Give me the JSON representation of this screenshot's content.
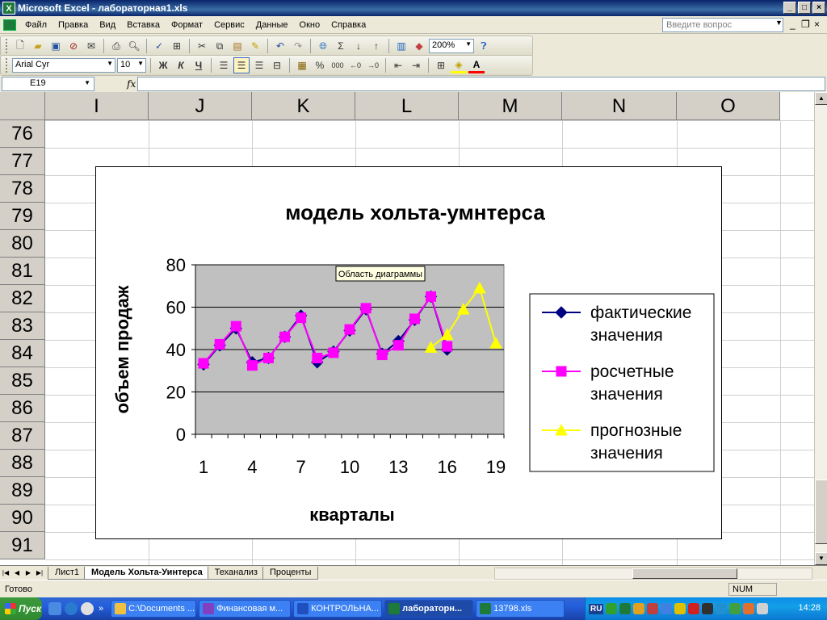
{
  "window": {
    "title": "Microsoft Excel - лабораторная1.xls",
    "minimize": "_",
    "maximize": "□",
    "close": "×"
  },
  "menu": {
    "items": [
      "Файл",
      "Правка",
      "Вид",
      "Вставка",
      "Формат",
      "Сервис",
      "Данные",
      "Окно",
      "Справка"
    ],
    "ask_placeholder": "Введите вопрос"
  },
  "toolbar": {
    "zoom": "200%",
    "font_name": "Arial Cyr",
    "font_size": "10",
    "bold": "Ж",
    "italic": "К",
    "underline": "Ч",
    "percent": "%",
    "thousands": "000",
    "sum": "Σ"
  },
  "formula_bar": {
    "name_box": "E19",
    "fx": "fx",
    "content": ""
  },
  "sheet": {
    "columns": [
      "I",
      "J",
      "K",
      "L",
      "M",
      "N",
      "O"
    ],
    "rows": [
      "76",
      "77",
      "78",
      "79",
      "80",
      "81",
      "82",
      "83",
      "84",
      "85",
      "86",
      "87",
      "88",
      "89",
      "90",
      "91"
    ]
  },
  "chart_data": {
    "type": "line",
    "title": "модель хольта-умнтерса",
    "xlabel": "кварталы",
    "ylabel": "объем продаж",
    "tooltip": "Область диаграммы",
    "x": [
      1,
      2,
      3,
      4,
      5,
      6,
      7,
      8,
      9,
      10,
      11,
      12,
      13,
      14,
      15,
      16,
      17,
      18,
      19
    ],
    "x_tick_labels": [
      "1",
      "4",
      "7",
      "10",
      "13",
      "16",
      "19"
    ],
    "ylim": [
      0,
      80
    ],
    "y_ticks": [
      0,
      20,
      40,
      60,
      80
    ],
    "grid": true,
    "legend_position": "right",
    "plot_background": "#c0c0c0",
    "series": [
      {
        "name": "фактические значения",
        "color": "#000080",
        "marker": "diamond",
        "x": [
          1,
          2,
          3,
          4,
          5,
          6,
          7,
          8,
          9,
          10,
          11,
          12,
          13,
          14,
          15,
          16
        ],
        "values": [
          33,
          42,
          50,
          34,
          36,
          46,
          56,
          34,
          39,
          49,
          59,
          38,
          44,
          54,
          65,
          40
        ]
      },
      {
        "name": "росчетные значения",
        "color": "#ff00ff",
        "marker": "square",
        "x": [
          1,
          2,
          3,
          4,
          5,
          6,
          7,
          8,
          9,
          10,
          11,
          12,
          13,
          14,
          15,
          16
        ],
        "values": [
          33.5,
          42.5,
          51,
          32.5,
          36,
          46,
          55,
          36,
          38.5,
          49.5,
          59.5,
          37.5,
          42,
          54.5,
          65,
          41.5
        ]
      },
      {
        "name": "прогнозные значения",
        "color": "#ffff00",
        "marker": "triangle",
        "x": [
          15,
          16,
          17,
          18,
          19
        ],
        "values": [
          41,
          47,
          59,
          69,
          43
        ]
      }
    ]
  },
  "sheet_tabs": {
    "tabs": [
      "Лист1",
      "Модель Хольта-Уинтерса",
      "Теханализ",
      "Проценты"
    ],
    "active": 1
  },
  "status": {
    "text": "Готово",
    "num": "NUM"
  },
  "taskbar": {
    "start": "Пуск",
    "buttons": [
      {
        "label": "C:\\Documents ...",
        "color": "#f0c040"
      },
      {
        "label": "Финансовая м...",
        "color": "#8040c0"
      },
      {
        "label": "КОНТРОЛЬНА...",
        "color": "#2050c0"
      },
      {
        "label": "лабораторн...",
        "color": "#1d7a3a",
        "active": true
      },
      {
        "label": "13798.xls",
        "color": "#1d7a3a"
      }
    ],
    "lang": "RU",
    "clock": "14:28"
  }
}
